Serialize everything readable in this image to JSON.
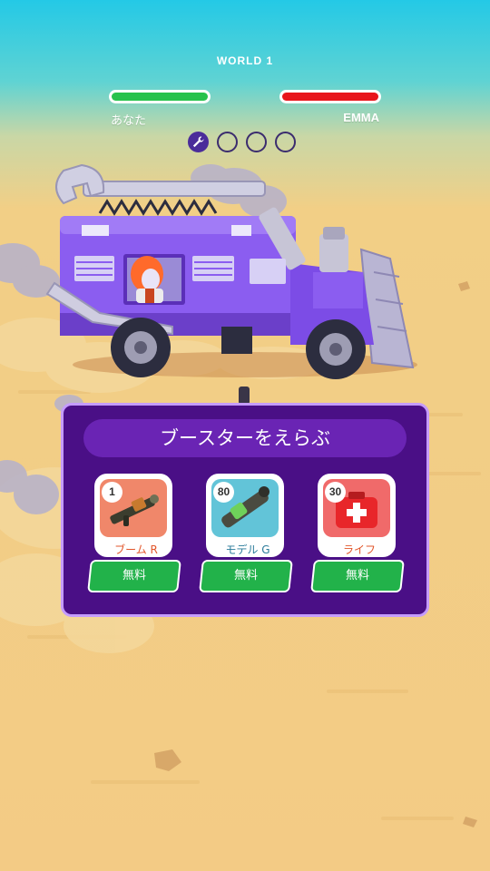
{
  "world": {
    "label": "WORLD 1"
  },
  "players": {
    "player": {
      "name": "あなた",
      "health": 1.0,
      "color": "#27c24c"
    },
    "enemy": {
      "name": "EMMA",
      "health": 1.0,
      "color": "#e8151b"
    }
  },
  "stage_progress": {
    "total": 4,
    "current": 1,
    "icon": "wrench-icon"
  },
  "booster_panel": {
    "title": "ブースターをえらぶ",
    "cards": [
      {
        "badge": "1",
        "label": "ブーム R",
        "icon": "rocket-launcher-icon",
        "button": "無料"
      },
      {
        "badge": "80",
        "label": "モデル G",
        "icon": "cannon-icon",
        "button": "無料"
      },
      {
        "badge": "30",
        "label": "ライフ",
        "icon": "first-aid-kit-icon",
        "button": "無料"
      }
    ]
  }
}
